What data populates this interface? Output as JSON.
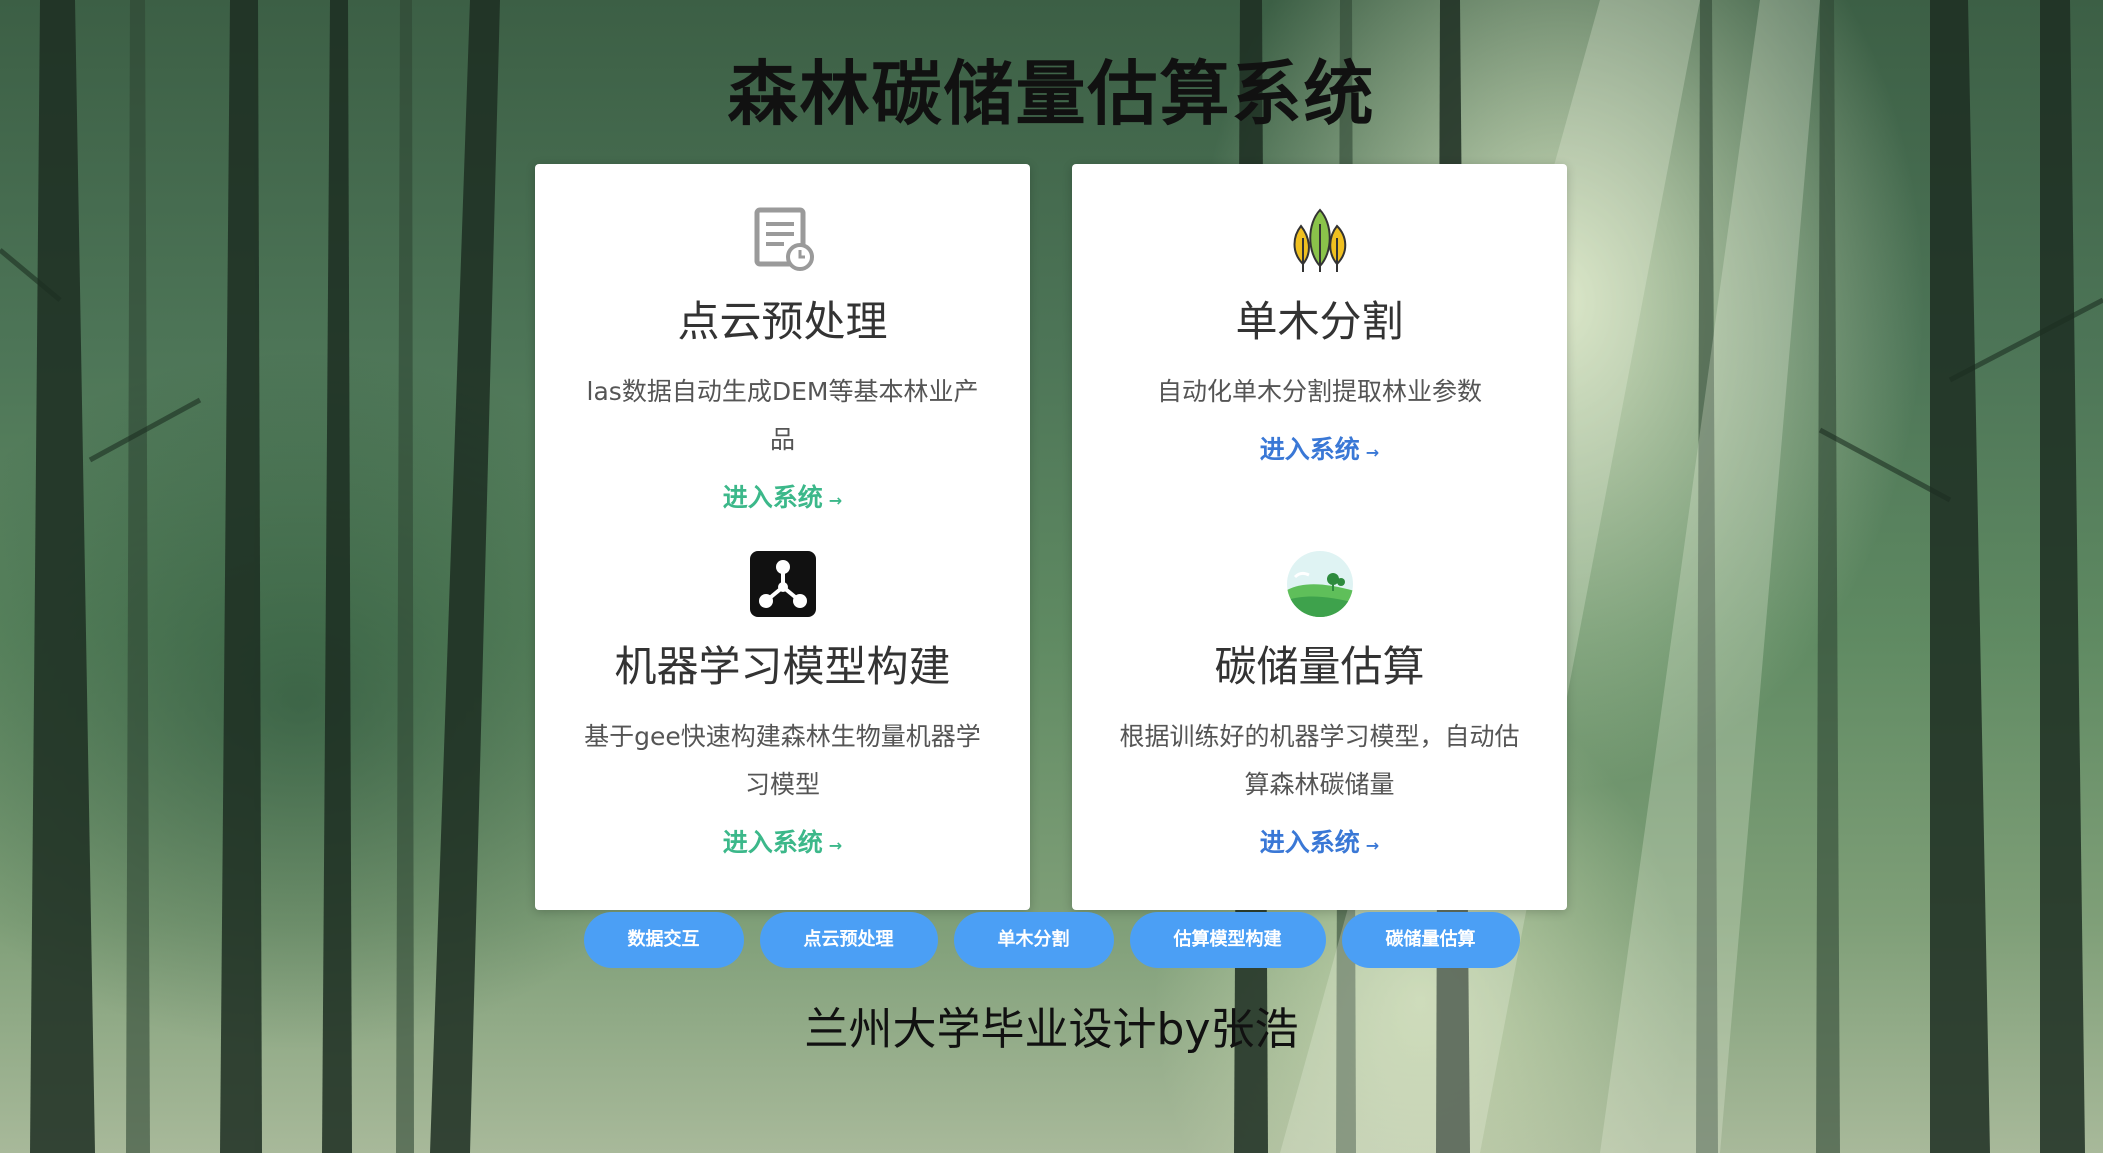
{
  "header": {
    "title": "森林碳储量估算系统"
  },
  "cards": {
    "point_cloud": {
      "icon": "report-clock-icon",
      "title": "点云预处理",
      "description": "las数据自动生成DEM等基本林业产品",
      "link": "进入系统",
      "link_color": "#3cb88a"
    },
    "tree_segmentation": {
      "icon": "trees-icon",
      "title": "单木分割",
      "description": "自动化单木分割提取林业参数",
      "link": "进入系统",
      "link_color": "#3a78d6"
    },
    "ml_model": {
      "icon": "network-nodes-icon",
      "title": "机器学习模型构建",
      "description": "基于gee快速构建森林生物量机器学习模型",
      "link": "进入系统",
      "link_color": "#3cb88a"
    },
    "carbon_estimation": {
      "icon": "landscape-icon",
      "title": "碳储量估算",
      "description": "根据训练好的机器学习模型，自动估算森林碳储量",
      "link": "进入系统",
      "link_color": "#3a78d6"
    }
  },
  "nav": {
    "buttons": [
      "数据交互",
      "点云预处理",
      "单木分割",
      "估算模型构建",
      "碳储量估算"
    ],
    "color": "#4b9ff5"
  },
  "footer": {
    "text": "兰州大学毕业设计by张浩"
  }
}
